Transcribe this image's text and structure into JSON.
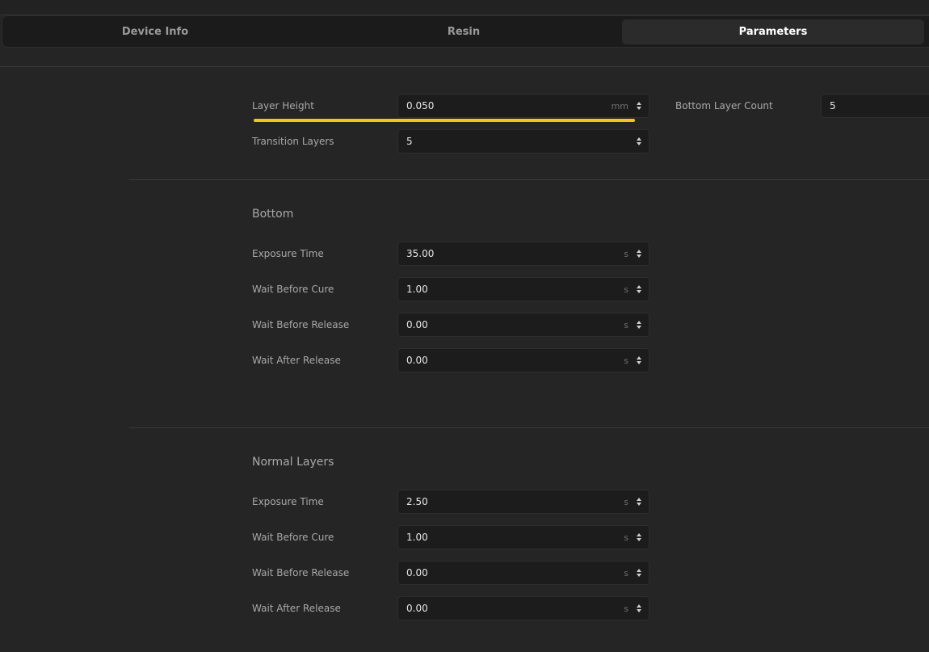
{
  "tabs": [
    {
      "label": "Device Info",
      "active": false
    },
    {
      "label": "Resin",
      "active": false
    },
    {
      "label": "Parameters",
      "active": true
    }
  ],
  "general": {
    "layer_height": {
      "label": "Layer Height",
      "value": "0.050",
      "unit": "mm"
    },
    "layer_height_progress": 1.0,
    "bottom_layer_count": {
      "label": "Bottom Layer Count",
      "value": "5"
    },
    "transition_layers": {
      "label": "Transition Layers",
      "value": "5"
    }
  },
  "bottom": {
    "title": "Bottom",
    "fields": [
      {
        "label": "Exposure Time",
        "value": "35.00",
        "unit": "s"
      },
      {
        "label": "Wait Before Cure",
        "value": "1.00",
        "unit": "s"
      },
      {
        "label": "Wait Before Release",
        "value": "0.00",
        "unit": "s"
      },
      {
        "label": "Wait After Release",
        "value": "0.00",
        "unit": "s"
      }
    ]
  },
  "normal": {
    "title": "Normal Layers",
    "fields": [
      {
        "label": "Exposure Time",
        "value": "2.50",
        "unit": "s"
      },
      {
        "label": "Wait Before Cure",
        "value": "1.00",
        "unit": "s"
      },
      {
        "label": "Wait Before Release",
        "value": "0.00",
        "unit": "s"
      },
      {
        "label": "Wait After Release",
        "value": "0.00",
        "unit": "s"
      }
    ]
  },
  "colors": {
    "background": "#252525",
    "field_background": "#1c1c1c",
    "accent": "#f5c518",
    "active_tab": "#2b2b2b"
  }
}
